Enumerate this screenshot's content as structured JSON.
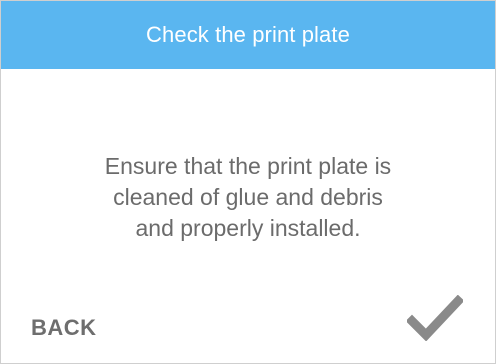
{
  "dialog": {
    "title": "Check the print plate",
    "message_lines": [
      "Ensure that the print plate is",
      "cleaned of glue and debris",
      "and properly installed."
    ],
    "back_label": "BACK",
    "confirm_icon": "checkmark-icon"
  },
  "colors": {
    "title_bar": "#5ab6f0",
    "title_text": "#ffffff",
    "body_text": "#6b6b6b",
    "check": "#8a8a8a"
  }
}
